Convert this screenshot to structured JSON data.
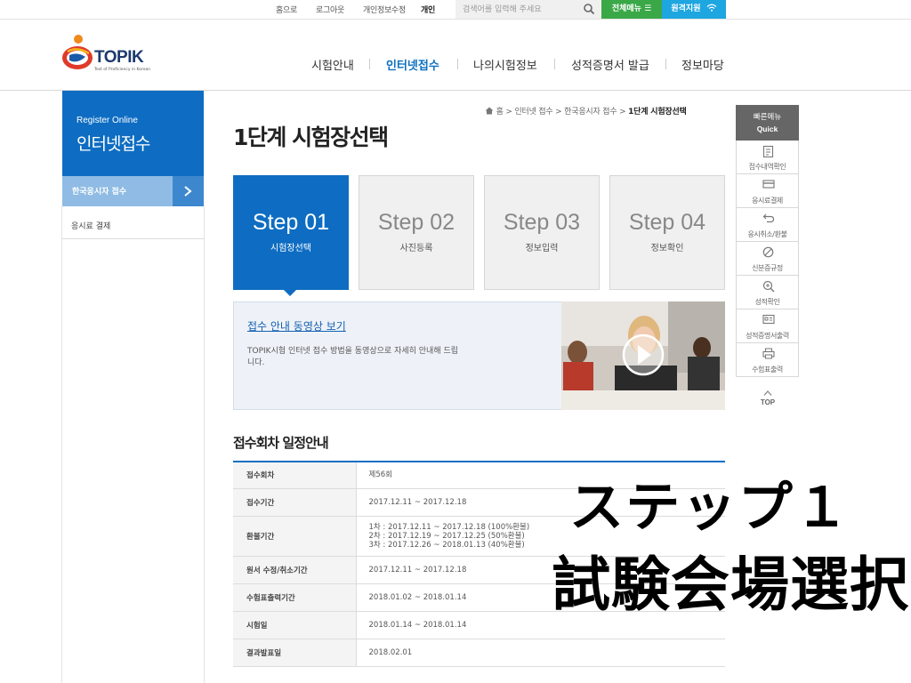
{
  "util": {
    "home": "홈으로",
    "logout": "로그아웃",
    "edit_info": "개인정보수정",
    "personal": "개인",
    "search_placeholder": "검색어를 입력해 주세요",
    "all_menu": "전체메뉴 ☰",
    "remote": "원격지원"
  },
  "logo": {
    "name": "TOPIK",
    "sub": "Test of Proficiency in Korean"
  },
  "gnb": [
    "시험안내",
    "인터넷접수",
    "나의시험정보",
    "성적증명서 발급",
    "정보마당"
  ],
  "sidebar": {
    "eng_title": "Register Online",
    "title": "인터넷접수",
    "items": [
      "한국응시자 접수",
      "응시료 결제"
    ]
  },
  "breadcrumb": {
    "home": "홈",
    "items": [
      "인터넷 접수",
      "한국응시자 접수"
    ],
    "current": "1단계 시험장선택"
  },
  "page_title": "1단계 시험장선택",
  "steps": [
    {
      "num": "Step 01",
      "label": "시험장선택"
    },
    {
      "num": "Step 02",
      "label": "사진등록"
    },
    {
      "num": "Step 03",
      "label": "정보입력"
    },
    {
      "num": "Step 04",
      "label": "정보확인"
    }
  ],
  "video": {
    "link": "접수 안내 동영상 보기",
    "desc": "TOPIK시험 인터넷 접수 방법을 동영상으로 자세히 안내해 드립니다."
  },
  "schedule": {
    "title": "접수회차 일정안내",
    "rows": [
      {
        "label": "접수회차",
        "value": "제56회"
      },
      {
        "label": "접수기간",
        "value": "2017.12.11 ~ 2017.12.18"
      },
      {
        "label": "환불기간",
        "lines": [
          "1차 : 2017.12.11 ~ 2017.12.18 (100%환불)",
          "2차 : 2017.12.19 ~ 2017.12.25 (50%환불)",
          "3차 : 2017.12.26 ~ 2018.01.13 (40%환불)"
        ]
      },
      {
        "label": "원서 수정/취소기간",
        "value": "2017.12.11 ~ 2017.12.18"
      },
      {
        "label": "수험표출력기간",
        "value": "2018.01.02 ~ 2018.01.14"
      },
      {
        "label": "시험일",
        "value": "2018.01.14 ~ 2018.01.14"
      },
      {
        "label": "결과발표일",
        "value": "2018.02.01"
      }
    ]
  },
  "quick": {
    "head": "빠른메뉴",
    "head_en": "Quick",
    "items": [
      "접수내역확인",
      "응시료결제",
      "응시취소/환불",
      "신분증규정",
      "성적확인",
      "성적증명서출력",
      "수험표출력"
    ],
    "top": "TOP"
  },
  "caption": {
    "line1": "ステップ１",
    "line2": "試験会場選択"
  },
  "colors": {
    "primary": "#0e6dc2",
    "green": "#3aa847",
    "sky": "#1ea6e0"
  }
}
